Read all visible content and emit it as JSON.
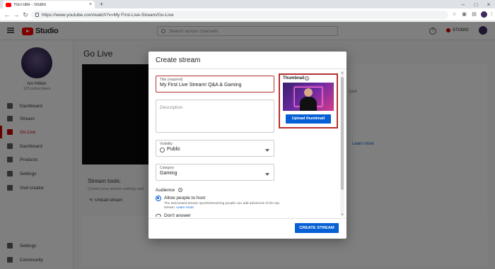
{
  "browser": {
    "tab_title": "YouTube - Studio",
    "tab_close": "×",
    "new_tab": "+",
    "url": "https://www.youtube.com/watch?v=My First-Live-Stream/Go-Live",
    "controls": {
      "minimize": "–",
      "maximize": "□",
      "close": "×"
    }
  },
  "header": {
    "logo_text": "Studio",
    "search_placeholder": "Search across channels",
    "help": "?",
    "studio_label": "STUDIO"
  },
  "sidebar": {
    "channel_name": "Ivo Hilton",
    "subscribers": "123 subscribers",
    "items": [
      {
        "label": "Dashboard",
        "icon": "dashboard-icon",
        "active": false
      },
      {
        "label": "Stream",
        "icon": "stream-icon",
        "active": false
      },
      {
        "label": "Go Live",
        "icon": "go-live-icon",
        "active": true
      },
      {
        "label": "Dashboard",
        "icon": "dashboard-icon",
        "active": false
      },
      {
        "label": "Products",
        "icon": "products-icon",
        "active": false
      },
      {
        "label": "Settings",
        "icon": "settings-icon",
        "active": false
      },
      {
        "label": "Visit creator",
        "icon": "feedback-icon",
        "active": false
      }
    ],
    "footer": [
      {
        "label": "Settings",
        "icon": "settings-icon"
      },
      {
        "label": "Community",
        "icon": "community-icon"
      }
    ]
  },
  "main": {
    "title": "Go Live",
    "stream_tools": "Stream tools:",
    "stream_tools_sub": "Control your stream settings and",
    "unload_stream": "Unload stream",
    "right_frag_1": "Q&A",
    "learn_more": "Learn more"
  },
  "dialog": {
    "title": "Create stream",
    "title_field": {
      "label": "Title (required)",
      "value": "My First Live Stream! Q&A & Gaming"
    },
    "description_field": {
      "label": "Description"
    },
    "visibility": {
      "label": "Visibility",
      "value": "Public"
    },
    "category": {
      "label": "Category",
      "value": "Gaming"
    },
    "thumbnail": {
      "label": "Thumbnail",
      "help": "?",
      "upload_label": "Upload thumbnail"
    },
    "audience": {
      "title": "Audience",
      "help": "?",
      "option_allow": "Allow people to host",
      "option_allow_sub": "The associated stream sports/streaming people can add advanced of the top stream.",
      "option_allow_link": "Learn more",
      "option_dont": "Don't answer"
    },
    "create_button": "CREATE STREAM"
  },
  "colors": {
    "accent_blue": "#065fd4",
    "focus_red": "#b53030",
    "brand_red": "#ff0000"
  }
}
